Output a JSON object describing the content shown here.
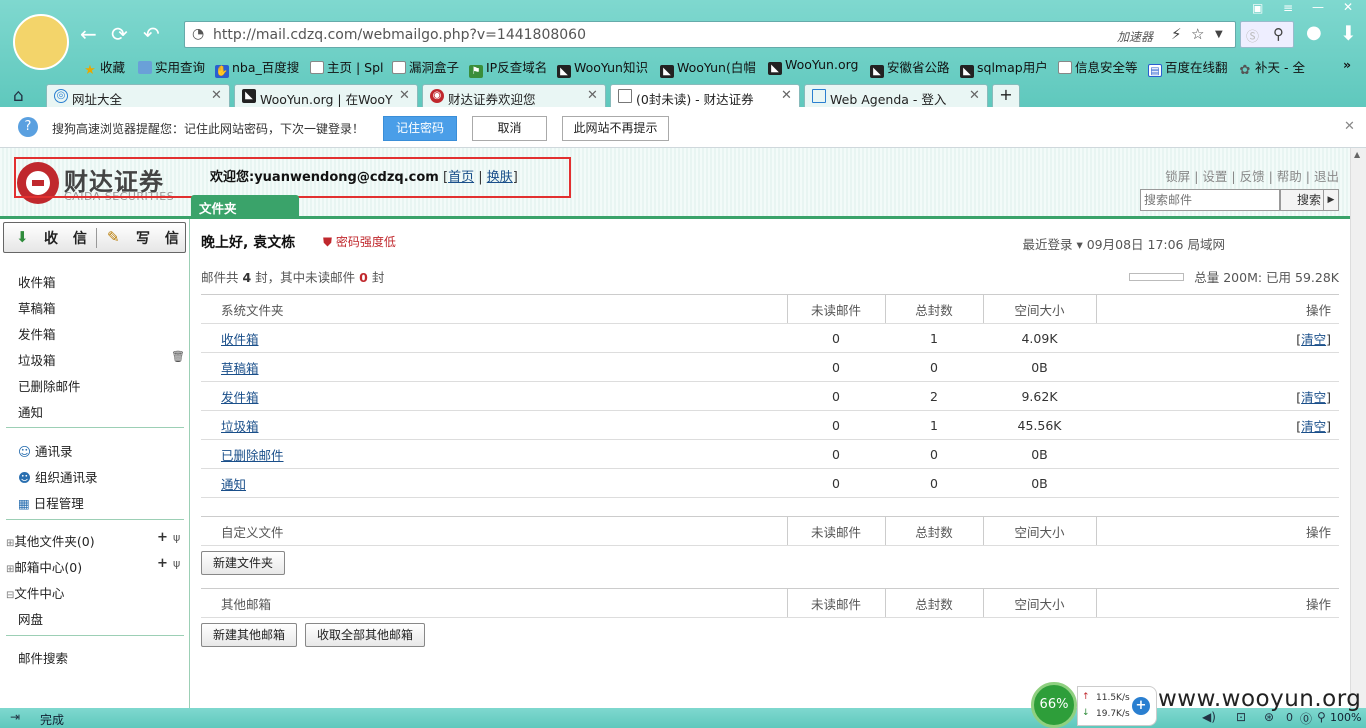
{
  "browser": {
    "url": "http://mail.cdzq.com/webmailgo.php?v=1441808060",
    "accelerator": "加速器",
    "bookmarks": [
      "收藏",
      "实用查询",
      "nba_百度搜",
      "主页 | Spl",
      "漏洞盒子",
      "IP反查域名",
      "WooYun知识",
      "WooYun(白帽",
      "WooYun.org",
      "安徽省公路",
      "sqlmap用户",
      "信息安全等",
      "百度在线翻",
      "补天 - 全"
    ],
    "tabs": [
      "网址大全",
      "WooYun.org | 在WooY",
      "财达证券欢迎您",
      "(0封未读) - 财达证券",
      "Web Agenda - 登入"
    ],
    "notification": {
      "text": "搜狗高速浏览器提醒您：记住此网站密码，下次一键登录！",
      "remember": "记住密码",
      "cancel": "取消",
      "never": "此网站不再提示"
    },
    "status_text": "完成",
    "gauge": "66%",
    "net_up": "11.5K/s",
    "net_down": "19.7K/s",
    "watermark": "www.wooyun.org",
    "zoom": "100%",
    "tray_count": "0"
  },
  "header": {
    "logo_cn": "财达证券",
    "logo_en": "CAIDA SECURITIES",
    "welcome_label": "欢迎您:",
    "user": "yuanwendong@cdzq.com",
    "home": "首页",
    "skin": "换肤",
    "links": [
      "锁屏",
      "设置",
      "反馈",
      "帮助",
      "退出"
    ],
    "search_placeholder": "搜索邮件",
    "search_btn": "搜索",
    "folder_tab": "文件夹"
  },
  "sidebar": {
    "receive": "收 信",
    "compose": "写 信",
    "folders": [
      "收件箱",
      "草稿箱",
      "发件箱",
      "垃圾箱",
      "已删除邮件",
      "通知"
    ],
    "tools": [
      "通讯录",
      "组织通讯录",
      "日程管理"
    ],
    "groups": [
      "其他文件夹(0)",
      "邮箱中心(0)",
      "文件中心"
    ],
    "disk": "网盘",
    "mail_search": "邮件搜索"
  },
  "main": {
    "greeting": "晚上好, 袁文栋",
    "pw_warning": "密码强度低",
    "last_login": "最近登录 ▾ 09月08日 17:06 局域网",
    "count_prefix": "邮件共 ",
    "count_total": "4",
    "count_mid": " 封，其中未读邮件 ",
    "count_unread": "0",
    "count_suffix": " 封",
    "quota": "总量 200M: 已用 59.28K",
    "sys_headers": [
      "系统文件夹",
      "未读邮件",
      "总封数",
      "空间大小",
      "操作"
    ],
    "sys_rows": [
      {
        "name": "收件箱",
        "unread": "0",
        "total": "1",
        "size": "4.09K",
        "op": "清空"
      },
      {
        "name": "草稿箱",
        "unread": "0",
        "total": "0",
        "size": "0B",
        "op": ""
      },
      {
        "name": "发件箱",
        "unread": "0",
        "total": "2",
        "size": "9.62K",
        "op": "清空"
      },
      {
        "name": "垃圾箱",
        "unread": "0",
        "total": "1",
        "size": "45.56K",
        "op": "清空"
      },
      {
        "name": "已删除邮件",
        "unread": "0",
        "total": "0",
        "size": "0B",
        "op": ""
      },
      {
        "name": "通知",
        "unread": "0",
        "total": "0",
        "size": "0B",
        "op": ""
      }
    ],
    "custom_headers": [
      "自定义文件",
      "未读邮件",
      "总封数",
      "空间大小",
      "操作"
    ],
    "new_folder": "新建文件夹",
    "other_headers": [
      "其他邮箱",
      "未读邮件",
      "总封数",
      "空间大小",
      "操作"
    ],
    "new_other": "新建其他邮箱",
    "fetch_all": "收取全部其他邮箱"
  }
}
